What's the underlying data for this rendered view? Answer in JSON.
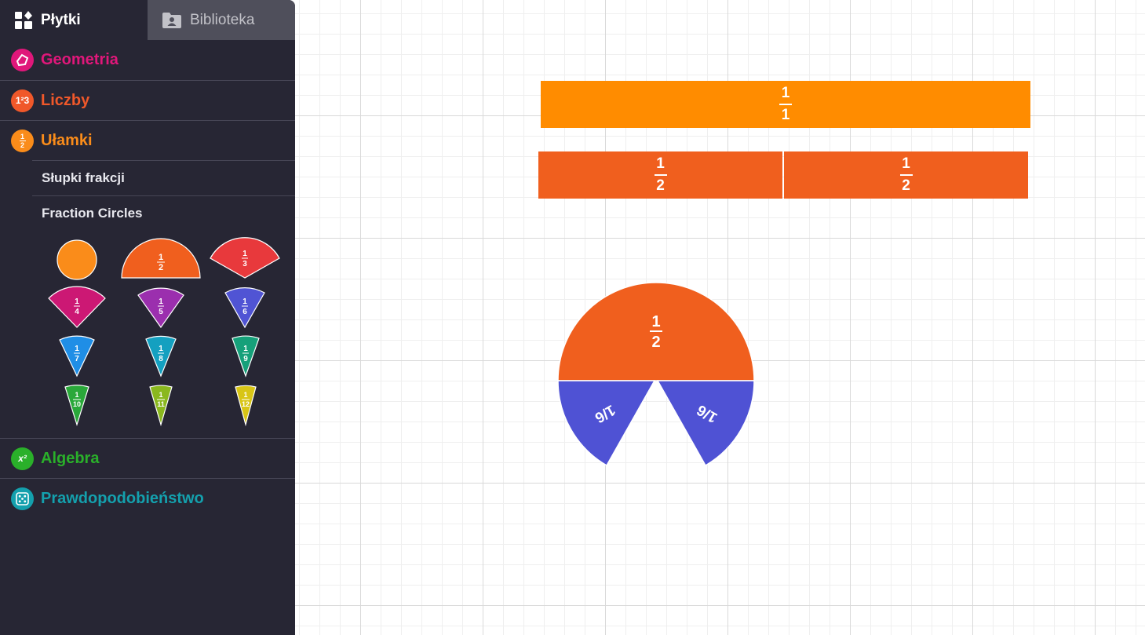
{
  "tabs": [
    {
      "label": "Płytki",
      "icon": "tiles-icon"
    },
    {
      "label": "Biblioteka",
      "icon": "folder-user-icon"
    }
  ],
  "categories": {
    "geometria": {
      "label": "Geometria",
      "color": "#e0177a"
    },
    "liczby": {
      "label": "Liczby",
      "color": "#f0582a",
      "icon_text": "1²3"
    },
    "ulamki": {
      "label": "Ułamki",
      "color": "#fa8c1a"
    },
    "algebra": {
      "label": "Algebra",
      "color": "#2ab02a",
      "icon_text": "x²"
    },
    "prawdopodobienstwo": {
      "label": "Prawdopodobieństwo",
      "color": "#14a0ad"
    }
  },
  "fraction_sub": {
    "bars_label": "Słupki frakcji",
    "circles_label": "Fraction Circles"
  },
  "palette": [
    {
      "num": "1",
      "den": "1",
      "color": "#fa8c1a"
    },
    {
      "num": "1",
      "den": "2",
      "color": "#f05f1e"
    },
    {
      "num": "1",
      "den": "3",
      "color": "#e8393c"
    },
    {
      "num": "1",
      "den": "4",
      "color": "#cc1874"
    },
    {
      "num": "1",
      "den": "5",
      "color": "#9b2fae"
    },
    {
      "num": "1",
      "den": "6",
      "color": "#5054d4"
    },
    {
      "num": "1",
      "den": "7",
      "color": "#1f8ee6"
    },
    {
      "num": "1",
      "den": "8",
      "color": "#14a0c0"
    },
    {
      "num": "1",
      "den": "9",
      "color": "#16a07a"
    },
    {
      "num": "1",
      "den": "10",
      "color": "#2aa83a"
    },
    {
      "num": "1",
      "den": "11",
      "color": "#8ab81e"
    },
    {
      "num": "1",
      "den": "12",
      "color": "#d8c516"
    }
  ],
  "canvas": {
    "bar_whole": {
      "num": "1",
      "den": "1",
      "color": "#ff8c00"
    },
    "bar_halves": [
      {
        "num": "1",
        "den": "2",
        "color": "#f05f1e"
      },
      {
        "num": "1",
        "den": "2",
        "color": "#f05f1e"
      }
    ],
    "circle_half": {
      "text": "1/2",
      "num": "1",
      "den": "2",
      "color": "#f05f1e"
    },
    "circle_sixths": [
      {
        "text": "1/6",
        "color": "#4f52d4"
      },
      {
        "text": "1/6",
        "color": "#4f52d4"
      }
    ]
  }
}
